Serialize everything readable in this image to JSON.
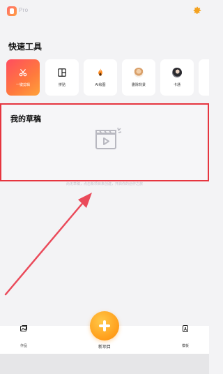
{
  "header": {
    "brand": "Pro",
    "settings_icon": "gear-icon"
  },
  "quick_tools": {
    "title": "快速工具",
    "items": [
      {
        "label": "一键剪辑",
        "icon": "scissors-icon",
        "highlighted": true
      },
      {
        "label": "拼贴",
        "icon": "layout-icon"
      },
      {
        "label": "AI绘图",
        "icon": "fire-icon"
      },
      {
        "label": "删除背景",
        "icon": "portrait-icon"
      },
      {
        "label": "卡通",
        "icon": "avatar-icon"
      }
    ]
  },
  "drafts": {
    "title": "我的草稿",
    "empty_hint": "尚无草稿，点击新项目来创建，开启你的创作之旅",
    "icon": "film-clapper-icon"
  },
  "bottom_nav": {
    "left": {
      "label": "作品",
      "icon": "gallery-icon"
    },
    "center": {
      "label": "新项目",
      "icon": "plus-icon"
    },
    "right": {
      "label": "模板",
      "icon": "template-icon"
    }
  },
  "colors": {
    "accent": "#ff9d1a",
    "highlight_border": "#e6353f",
    "primary_tool_gradient": [
      "#ff4d5f",
      "#ffa23a"
    ]
  }
}
